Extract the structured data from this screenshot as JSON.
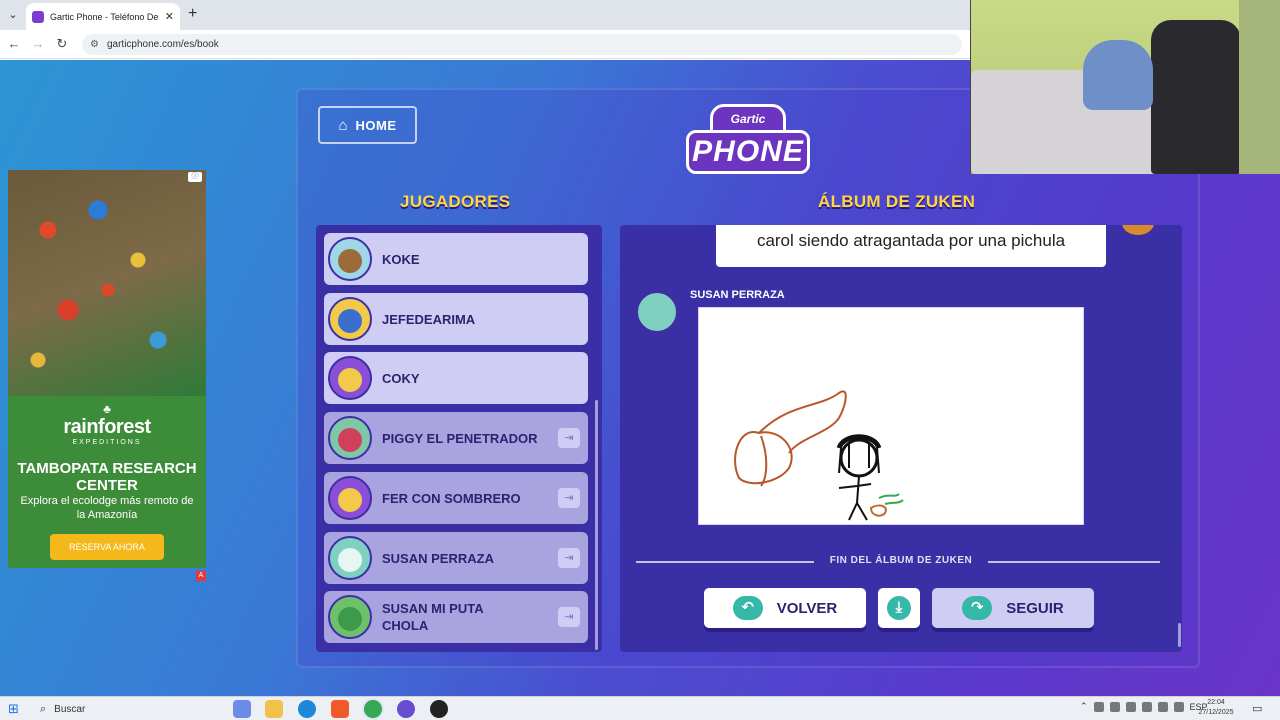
{
  "browser": {
    "tab_title": "Gartic Phone - Teléfono Descon",
    "tab_close": "✕",
    "new_tab": "+",
    "tab_list": "⌄",
    "back": "←",
    "forward": "→",
    "reload": "↻",
    "site_info": "⚙",
    "url": "garticphone.com/es/book"
  },
  "ad": {
    "badge": "ⓘ",
    "logo_mark": "♣",
    "brand": "rainforest",
    "brand_sub": "EXPEDITIONS",
    "title": "TAMBOPATA RESEARCH CENTER",
    "text": "Explora el ecolodge más remoto de la Amazonía",
    "cta": "RESERVA AHORA",
    "choice": "A"
  },
  "game": {
    "home_icon": "⌂",
    "home_label": "HOME",
    "logo_top": "Gartic",
    "logo_main": "PHONE",
    "players_title": "JUGADORES",
    "album_title": "ÁLBUM DE ZUKEN",
    "players": [
      {
        "name": "KOKE",
        "kick": ""
      },
      {
        "name": "JEFEDEARIMA",
        "kick": ""
      },
      {
        "name": "COKY",
        "kick": ""
      },
      {
        "name": "PIGGY EL PENETRADOR",
        "kick": "⇥"
      },
      {
        "name": "FER CON SOMBRERO",
        "kick": "⇥"
      },
      {
        "name": "SUSAN PERRAZA",
        "kick": "⇥"
      },
      {
        "name": "SUSAN MI PUTA CHOLA",
        "kick": "⇥"
      }
    ],
    "caption": "carol siendo atragantada por una pichula",
    "drawer_name": "SUSAN PERRAZA",
    "end_text": "FIN DEL ÁLBUM DE ZUKEN",
    "back_label": "VOLVER",
    "back_icon": "↶",
    "download_icon": "⤓",
    "next_label": "SEGUIR",
    "next_icon": "↷"
  },
  "taskbar": {
    "start_icon": "⊞",
    "search_icon": "⌕",
    "search_label": "Buscar",
    "tray_lang": "ESP",
    "tray_up": "⌃",
    "time": "22:04",
    "date": "27/12/2025",
    "notif": "▭"
  },
  "colors": {
    "accent_yellow": "#ffd740",
    "panel": "#3b2fa6",
    "teal": "#35b8a8"
  }
}
